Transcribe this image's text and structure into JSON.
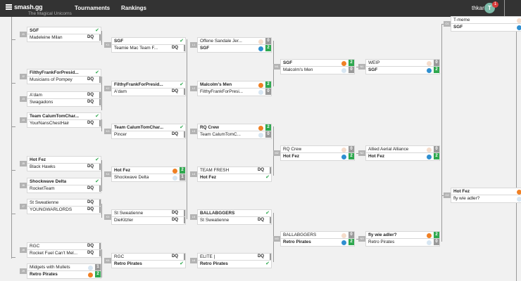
{
  "nav": {
    "logo": "smash.gg",
    "tournaments": "Tournaments",
    "rankings": "Rankings",
    "username": "thkara",
    "avatar_letter": "T",
    "notifications": "1"
  },
  "header_partial_text": "The Magical Unicorns",
  "matches": [
    {
      "id": "r1m1",
      "tag": "J1",
      "p1": "SGF",
      "p1_win": true,
      "p1_res": "check",
      "p2": "Madeleine Milan",
      "p2_win": false,
      "p2_res": "DQ"
    },
    {
      "id": "r1m2",
      "tag": "J2",
      "p1": "FilthyFrankForPresid...",
      "p1_win": true,
      "p1_res": "check",
      "p2": "Musicians of Pompey",
      "p2_win": false,
      "p2_res": "DQ"
    },
    {
      "id": "r1m3",
      "tag": "J3",
      "p1": "A'dam",
      "p1_win": false,
      "p1_res": "DQ",
      "p2": "Swagadons",
      "p2_win": false,
      "p2_res": "DQ"
    },
    {
      "id": "r1m4",
      "tag": "J4",
      "p1": "Team CalumTomChar...",
      "p1_win": true,
      "p1_res": "check",
      "p2": "YourNansChestHair",
      "p2_win": false,
      "p2_res": "DQ"
    },
    {
      "id": "r1m5",
      "tag": "J5",
      "p1": "Hot Fez",
      "p1_win": true,
      "p1_res": "check",
      "p2": "Black Hawks",
      "p2_win": false,
      "p2_res": "DQ"
    },
    {
      "id": "r1m6",
      "tag": "J6",
      "p1": "Shockwave Delta",
      "p1_win": true,
      "p1_res": "check",
      "p2": "RocketTeam",
      "p2_win": false,
      "p2_res": "DQ"
    },
    {
      "id": "r1m7",
      "tag": "J7",
      "p1": "St Sweatienne",
      "p1_win": false,
      "p1_res": "DQ",
      "p2": "YOUNGWARLORDS",
      "p2_win": false,
      "p2_res": "DQ"
    },
    {
      "id": "r1m8",
      "tag": "J8",
      "p1": "RGC",
      "p1_win": false,
      "p1_res": "DQ",
      "p2": "Rocket Fuel Can't Mel...",
      "p2_win": false,
      "p2_res": "DQ"
    },
    {
      "id": "r1m9",
      "tag": "J9",
      "p1": "Midgets with Mullets",
      "p1_win": false,
      "p1_res": "1",
      "p1_dot": "lightblue",
      "p2": "Retro Pirates",
      "p2_win": true,
      "p2_res": "2",
      "p2_dot": "orange"
    },
    {
      "id": "r2m1",
      "tag": "K1",
      "p1": "SGF",
      "p1_win": true,
      "p1_res": "check",
      "p2": "Teamie Mac Team F...",
      "p2_win": false,
      "p2_res": "DQ"
    },
    {
      "id": "r2m2",
      "tag": "K2",
      "p1": "FilthyFrankForPresid...",
      "p1_win": true,
      "p1_res": "check",
      "p2": "A'dam",
      "p2_win": false,
      "p2_res": "DQ"
    },
    {
      "id": "r2m3",
      "tag": "K3",
      "p1": "Team CalumTomChar...",
      "p1_win": true,
      "p1_res": "check",
      "p2": "Pincer",
      "p2_win": false,
      "p2_res": "DQ"
    },
    {
      "id": "r2m4",
      "tag": "K4",
      "p1": "Hot Fez",
      "p1_win": true,
      "p1_res": "2",
      "p1_dot": "orange",
      "p2": "Shockwave Delta",
      "p2_win": false,
      "p2_res": "1",
      "p2_dot": "lightblue"
    },
    {
      "id": "r2m5",
      "tag": "K5",
      "p1": "St Sweatienne",
      "p1_win": false,
      "p1_res": "DQ",
      "p2": "DieKitzler",
      "p2_win": false,
      "p2_res": "DQ"
    },
    {
      "id": "r2m6",
      "tag": "K6",
      "p1": "RGC",
      "p1_win": false,
      "p1_res": "DQ",
      "p2": "Retro Pirates",
      "p2_win": true,
      "p2_res": "check"
    },
    {
      "id": "r3m1",
      "tag": "L1",
      "p1": "Offene Sandale Jer...",
      "p1_win": false,
      "p1_res": "0",
      "p1_dot": "peach",
      "p2": "SGF",
      "p2_win": true,
      "p2_res": "2",
      "p2_dot": "blue"
    },
    {
      "id": "r3m2",
      "tag": "L2",
      "p1": "Malcolm's Men",
      "p1_win": true,
      "p1_res": "2",
      "p1_dot": "orange",
      "p2": "FilthyFrankForPresi...",
      "p2_win": false,
      "p2_res": "0",
      "p2_dot": "lightblue"
    },
    {
      "id": "r3m3",
      "tag": "L3",
      "p1": "RQ Crew",
      "p1_win": true,
      "p1_res": "2",
      "p1_dot": "orange",
      "p2": "Team CalumTomC...",
      "p2_win": false,
      "p2_res": "0",
      "p2_dot": "lightblue"
    },
    {
      "id": "r3m4",
      "tag": "L4",
      "p1": "TEAM FRESH",
      "p1_win": false,
      "p1_res": "DQ",
      "p2": "Hot Fez",
      "p2_win": true,
      "p2_res": "check"
    },
    {
      "id": "r3m5",
      "tag": "L5",
      "p1": "BALLABGGERS",
      "p1_win": true,
      "p1_res": "check",
      "p2": "St Sweatienne",
      "p2_win": false,
      "p2_res": "DQ"
    },
    {
      "id": "r3m6",
      "tag": "L6",
      "p1": "ELITE |",
      "p1_win": false,
      "p1_res": "DQ",
      "p2": "Retro Pirates",
      "p2_win": true,
      "p2_res": "check"
    },
    {
      "id": "r4m1",
      "tag": "M1",
      "p1": "SGF",
      "p1_win": true,
      "p1_res": "2",
      "p1_dot": "orange",
      "p2": "Malcolm's Men",
      "p2_win": false,
      "p2_res": "0",
      "p2_dot": "lightblue"
    },
    {
      "id": "r4m2",
      "tag": "M2",
      "p1": "RQ Crew",
      "p1_win": false,
      "p1_res": "0",
      "p1_dot": "peach",
      "p2": "Hot Fez",
      "p2_win": true,
      "p2_res": "2",
      "p2_dot": "blue"
    },
    {
      "id": "r4m3",
      "tag": "M3",
      "p1": "BALLABGGERS",
      "p1_win": false,
      "p1_res": "0",
      "p1_dot": "peach",
      "p2": "Retro Pirates",
      "p2_win": true,
      "p2_res": "2",
      "p2_dot": "blue"
    },
    {
      "id": "r5m1",
      "tag": "N1",
      "p1": "WEIP",
      "p1_win": false,
      "p1_res": "0",
      "p1_dot": "peach",
      "p2": "SGF",
      "p2_win": true,
      "p2_res": "2",
      "p2_dot": "blue"
    },
    {
      "id": "r5m2",
      "tag": "N2",
      "p1": "Allied Aerial Alliance",
      "p1_win": false,
      "p1_res": "0",
      "p1_dot": "peach",
      "p2": "Hot Fez",
      "p2_win": true,
      "p2_res": "2",
      "p2_dot": "blue"
    },
    {
      "id": "r5m3",
      "tag": "N3",
      "p1": "fly wie adler?",
      "p1_win": true,
      "p1_res": "2",
      "p1_dot": "orange",
      "p2": "Retro Pirates",
      "p2_win": false,
      "p2_res": "0",
      "p2_dot": "lightblue"
    },
    {
      "id": "r6m1",
      "tag": "O1",
      "p1": "T-meme",
      "p1_win": false,
      "p1_res": "bar-l",
      "p1_dot": "peach",
      "p2": "SGF",
      "p2_win": true,
      "p2_res": "bar-w",
      "p2_dot": "blue"
    },
    {
      "id": "r6m2",
      "tag": "O2",
      "p1": "Hot Fez",
      "p1_win": true,
      "p1_res": "bar-w",
      "p1_dot": "orange",
      "p2": "fly wie adler?",
      "p2_win": false,
      "p2_res": "bar-l",
      "p2_dot": "lightblue"
    }
  ]
}
